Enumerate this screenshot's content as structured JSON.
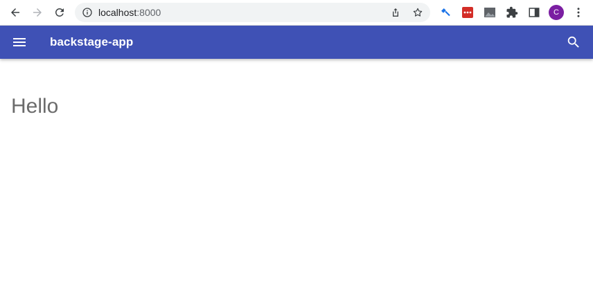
{
  "browser": {
    "url_host": "localhost",
    "url_port": ":8000",
    "profile_initial": "C"
  },
  "app": {
    "title": "backstage-app",
    "color": "#3f51b5"
  },
  "main": {
    "greeting": "Hello"
  },
  "icons": [
    "back-icon",
    "forward-icon",
    "reload-icon",
    "info-icon",
    "share-icon",
    "star-icon",
    "extension-icons",
    "puzzle-icon",
    "sidepanel-icon",
    "more-icon",
    "menu-icon",
    "search-icon"
  ]
}
